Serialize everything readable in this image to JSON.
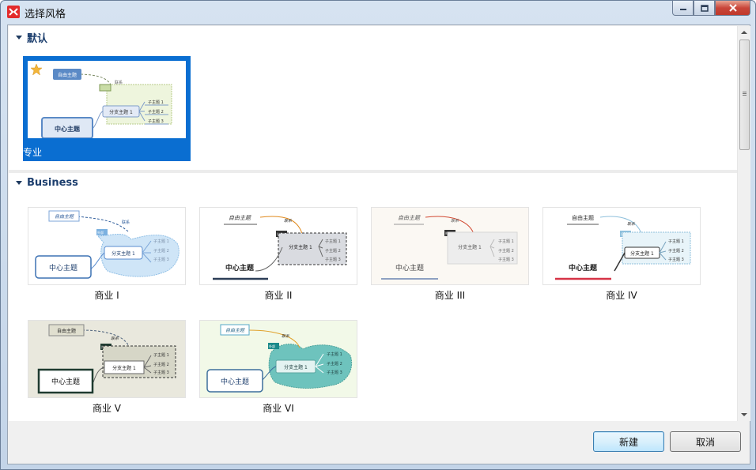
{
  "window": {
    "title": "选择风格"
  },
  "sections": {
    "default": {
      "label": "默认"
    },
    "business": {
      "label": "Business"
    }
  },
  "mindmap": {
    "central": "中心主题",
    "branch": "分支主题 1",
    "floating": "自由主题",
    "relation": "联系",
    "summary": "外部",
    "sub1": "子主题 1",
    "sub2": "子主题 2",
    "sub3": "子主题 3"
  },
  "styles": {
    "default_card": {
      "label": "专业"
    },
    "cards": [
      {
        "label": "商业 I"
      },
      {
        "label": "商业 II"
      },
      {
        "label": "商业 III"
      },
      {
        "label": "商业 IV"
      },
      {
        "label": "商业 V"
      },
      {
        "label": "商业 VI"
      }
    ]
  },
  "buttons": {
    "new": "新建",
    "cancel": "取消"
  },
  "colors": {
    "selection": "#0a6ed1",
    "accent_red": "#e32b2b",
    "card_bg_v": "#e9e8dd",
    "card_bg_vi": "#f2f9e8",
    "card_bg_iii": "#fbf8f3"
  }
}
